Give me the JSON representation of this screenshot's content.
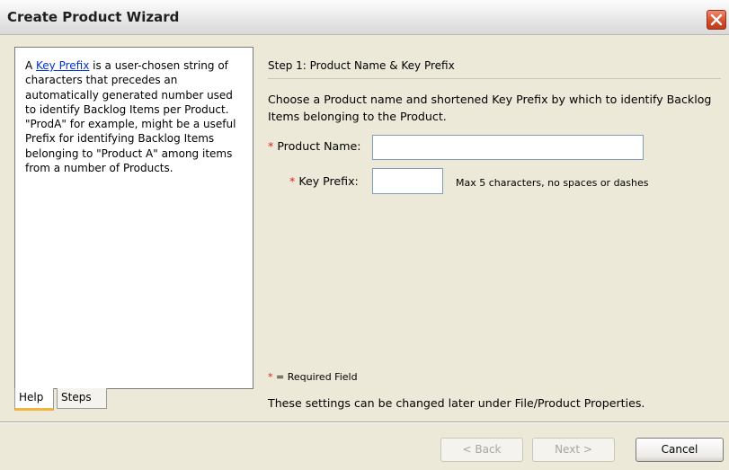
{
  "window": {
    "title": "Create Product Wizard",
    "close_label": "X"
  },
  "help": {
    "link_text": "Key Prefix",
    "text": " is a user-chosen string of characters that precedes an automatically generated number used to identify Backlog Items per Product. \"ProdA\" for example, might be a useful Prefix for identifying Backlog Items belonging to \"Product A\" among items from a number of Products.",
    "tabs": [
      "Help",
      "Steps"
    ],
    "active_tab": "Help"
  },
  "step": {
    "title": "Step 1: Product Name & Key Prefix",
    "description": "Choose a Product name and shortened Key Prefix by which to identify Backlog Items belonging to the Product."
  },
  "form": {
    "required_mark": "*",
    "product_name_label": "Product Name:",
    "product_name_value": "",
    "key_prefix_label": "Key Prefix:",
    "key_prefix_value": "",
    "key_prefix_hint": "Max 5 characters, no spaces or dashes",
    "required_legend": "= Required Field",
    "note": "These settings can be changed later under File/Product Properties."
  },
  "buttons": {
    "back": "< Back",
    "next": "Next >",
    "cancel": "Cancel"
  },
  "colors": {
    "required": "#e02020",
    "link": "#0033cc",
    "active_tab_underline": "#f5b33d",
    "close_button": "#d4502d"
  }
}
